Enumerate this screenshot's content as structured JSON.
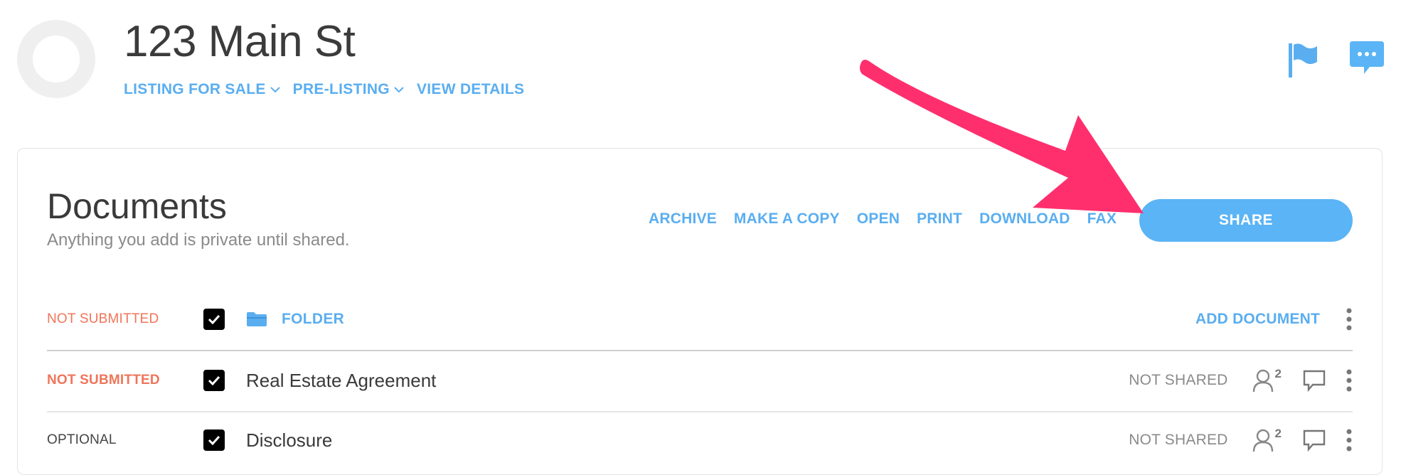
{
  "header": {
    "address": "123 Main St",
    "subnav": [
      {
        "label": "LISTING FOR SALE",
        "dropdown": true
      },
      {
        "label": "PRE-LISTING",
        "dropdown": true
      },
      {
        "label": "VIEW DETAILS",
        "dropdown": false
      }
    ],
    "icons": [
      "flag-icon",
      "chat-icon"
    ]
  },
  "documents": {
    "title": "Documents",
    "subtitle": "Anything you add is private until shared.",
    "actions": [
      "ARCHIVE",
      "MAKE A COPY",
      "OPEN",
      "PRINT",
      "DOWNLOAD",
      "FAX"
    ],
    "share_label": "SHARE",
    "folder": {
      "status": "NOT SUBMITTED",
      "label": "FOLDER",
      "add_label": "ADD DOCUMENT",
      "checked": true
    },
    "rows": [
      {
        "status": "NOT SUBMITTED",
        "name": "Real Estate Agreement",
        "share_state": "NOT SHARED",
        "people_count": "2",
        "checked": true
      },
      {
        "status": "OPTIONAL",
        "name": "Disclosure",
        "share_state": "NOT SHARED",
        "people_count": "2",
        "checked": true
      }
    ]
  },
  "colors": {
    "accent": "#5aaef0",
    "share_button": "#5ab4f5",
    "status_orange": "#f0755a",
    "annotation_arrow": "#ff2f6e"
  }
}
